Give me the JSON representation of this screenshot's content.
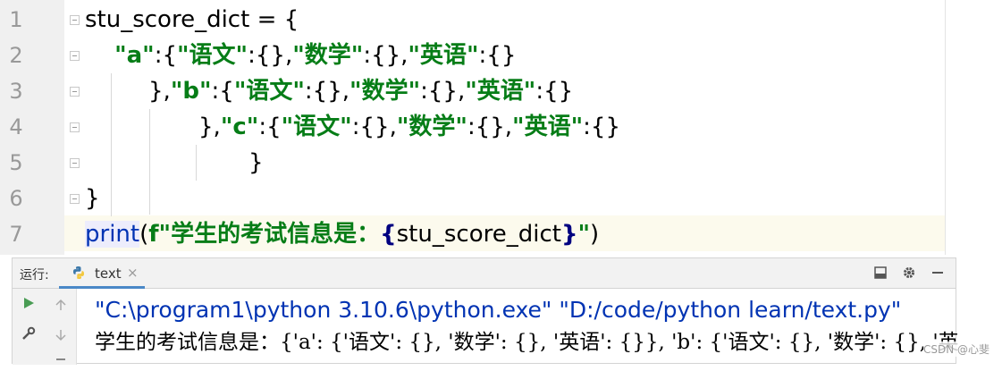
{
  "editor": {
    "line_numbers": [
      "1",
      "2",
      "3",
      "4",
      "5",
      "6",
      "7"
    ],
    "line1": {
      "var": "stu_score_dict = {"
    },
    "line2": {
      "indent": "    ",
      "k": "\"a\"",
      "p1": ":{",
      "s1": "\"语文\"",
      "p2": ":{},",
      "s2": "\"数学\"",
      "p3": ":{},",
      "s3": "\"英语\"",
      "p4": ":{}"
    },
    "line3": {
      "p0": "},",
      "k": "\"b\"",
      "p1": ":{",
      "s1": "\"语文\"",
      "p2": ":{},",
      "s2": "\"数学\"",
      "p3": ":{},",
      "s3": "\"英语\"",
      "p4": ":{}"
    },
    "line4": {
      "p0": "},",
      "k": "\"c\"",
      "p1": ":{",
      "s1": "\"语文\"",
      "p2": ":{},",
      "s2": "\"数学\"",
      "p3": ":{},",
      "s3": "\"英语\"",
      "p4": ":{}"
    },
    "line5": {
      "text": "}"
    },
    "line6": {
      "text": "}"
    },
    "line7": {
      "fn": "print",
      "open": "(",
      "fprefix": "f\"",
      "ftext": "学生的考试信息是：",
      "lb": "{",
      "var": "stu_score_dict",
      "rb": "}",
      "fend": "\"",
      "close": ")"
    }
  },
  "run_panel": {
    "label": "运行:",
    "tab_label": "text",
    "tab_close": "×",
    "output": [
      "\"C:\\program1\\python 3.10.6\\python.exe\" \"D:/code/python learn/text.py\"",
      "学生的考试信息是：{'a': {'语文': {}, '数学': {}, '英语': {}}, 'b': {'语文': {}, '数学': {}, '英"
    ]
  },
  "watermark": "CSDN @心斐",
  "colors": {
    "string": "#067d17",
    "keyword": "#0033b3",
    "brace": "#000080",
    "gutter": "#f0f0f0",
    "current_line": "#fcfaed",
    "tab_accent": "#4a88c7",
    "run_icon": "#499c54"
  },
  "icons": {
    "run": "play-icon",
    "up": "arrow-up-icon",
    "down": "arrow-down-icon",
    "wrench": "wrench-icon",
    "layout": "layout-icon",
    "settings": "gear-icon",
    "minimize": "minimize-icon",
    "python": "python-icon",
    "fold": "fold-marker-icon"
  }
}
